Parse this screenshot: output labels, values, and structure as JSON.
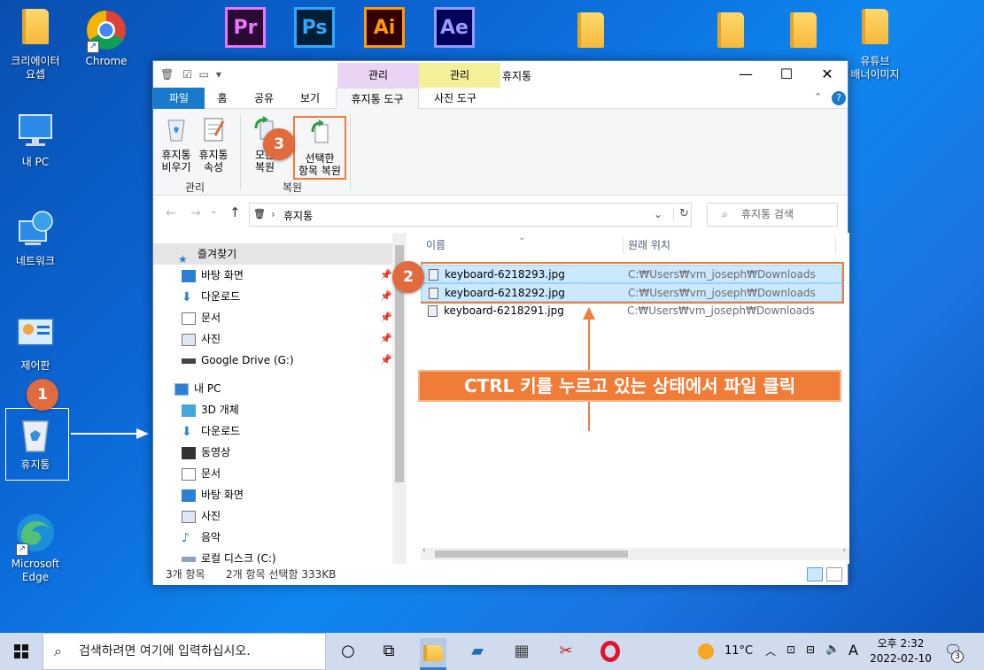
{
  "desktop": {
    "icons": [
      {
        "label": "크리에이터\n요셉"
      },
      {
        "label": "Chrome"
      },
      {
        "label": "내 PC"
      },
      {
        "label": "네트워크"
      },
      {
        "label": "제어판"
      },
      {
        "label": "휴지통"
      },
      {
        "label": "Microsoft\nEdge"
      },
      {
        "label": "유튜브\n배너이미지"
      }
    ],
    "adobe_apps": [
      {
        "label": "Pr",
        "color": "#ea77ff",
        "bg": "#2a0a33"
      },
      {
        "label": "Ps",
        "color": "#31a8ff",
        "bg": "#001e36"
      },
      {
        "label": "Ai",
        "color": "#ff9a00",
        "bg": "#330000"
      },
      {
        "label": "Ae",
        "color": "#9999ff",
        "bg": "#00005b"
      }
    ]
  },
  "window": {
    "title": "휴지통",
    "context_tabs": {
      "manage_1": "관리",
      "manage_2": "관리"
    },
    "tabs": {
      "file": "파일",
      "home": "홈",
      "share": "공유",
      "view": "보기",
      "recycle_tools": "휴지통 도구",
      "picture_tools": "사진 도구"
    },
    "ribbon": {
      "empty_bin": "휴지통\n비우기",
      "bin_props": "휴지통\n속성",
      "restore_all": "모든\n복원",
      "restore_selected": "선택한\n항목 복원",
      "group_manage": "관리",
      "group_restore": "복원"
    },
    "address": {
      "path": "휴지통",
      "search_placeholder": "휴지통 검색"
    },
    "nav": {
      "quick_access": "즐겨찾기",
      "items": [
        "바탕 화면",
        "다운로드",
        "문서",
        "사진",
        "Google Drive (G:)"
      ],
      "this_pc": "내 PC",
      "pc_items": [
        "3D 개체",
        "다운로드",
        "동영상",
        "문서",
        "바탕 화면",
        "사진",
        "음악",
        "로컬 디스크 (C:)"
      ]
    },
    "columns": {
      "name": "이름",
      "original_location": "원래 위치"
    },
    "files": [
      {
        "name": "keyboard-6218293.jpg",
        "location": "C:₩Users₩vm_joseph₩Downloads",
        "selected": true
      },
      {
        "name": "keyboard-6218292.jpg",
        "location": "C:₩Users₩vm_joseph₩Downloads",
        "selected": true
      },
      {
        "name": "keyboard-6218291.jpg",
        "location": "C:₩Users₩vm_joseph₩Downloads",
        "selected": false
      }
    ],
    "status": {
      "count": "3개 항목",
      "selection": "2개 항목 선택함 333KB"
    }
  },
  "annotations": {
    "step1": "1",
    "step2": "2",
    "step3": "3",
    "callout": "CTRL 키를 누르고 있는 상태에서 파일 클릭"
  },
  "taskbar": {
    "search_placeholder": "검색하려면 여기에 입력하십시오.",
    "weather": "11°C",
    "ime": "A",
    "time": "오후 2:32",
    "date": "2022-02-10",
    "notification_count": "3"
  }
}
